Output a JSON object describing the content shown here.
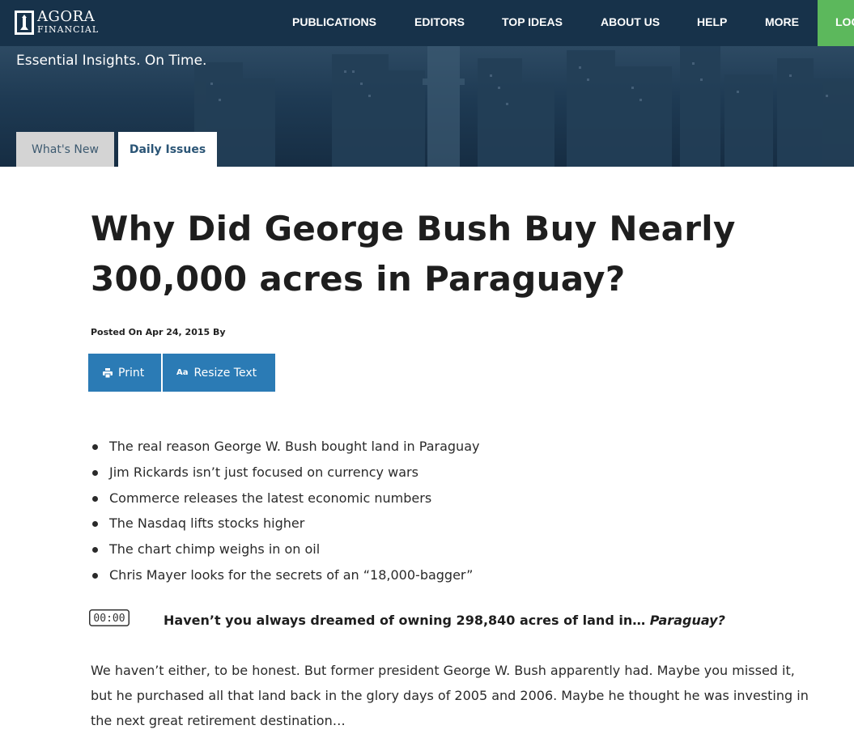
{
  "brand": {
    "name_top": "AGORA",
    "name_bottom": "FINANCIAL"
  },
  "nav": {
    "items": [
      "PUBLICATIONS",
      "EDITORS",
      "TOP IDEAS",
      "ABOUT US",
      "HELP",
      "MORE"
    ],
    "login": "LOGIN"
  },
  "hero": {
    "tagline": "Essential Insights. On Time.",
    "tabs": [
      "What's New",
      "Daily Issues"
    ]
  },
  "article": {
    "title": "Why Did George Bush Buy Nearly 300,000 acres in Paraguay?",
    "meta": "Posted On Apr 24, 2015 By",
    "print_label": "Print",
    "resize_label": "Resize Text",
    "aa_glyph": "Aa",
    "bullets": [
      "The real reason George W. Bush bought land in Paraguay",
      "Jim Rickards isn’t just focused on currency wars",
      "Commerce releases the latest economic numbers",
      "The Nasdaq lifts stocks higher",
      "The chart chimp weighs in on oil",
      "Chris Mayer looks for the secrets of an “18,000-bagger”"
    ],
    "timer_text": "00:00",
    "lead": "Haven’t you always dreamed of owning 298,840 acres of land in…",
    "lead_em": "Paraguay?",
    "paragraph": "We haven’t either, to be honest. But former president George W. Bush apparently had. Maybe you missed it, but he purchased all that land back in the glory days of 2005 and 2006. Maybe he thought he was investing in the next great retirement destination…"
  },
  "colors": {
    "nav_bg": "#17324a",
    "login_bg": "#5cb85c",
    "button_bg": "#2b7bb5",
    "tab_inactive": "#d4d4d4"
  },
  "icons": [
    "agora-logo-icon",
    "printer-icon",
    "text-size-icon",
    "timer-icon"
  ]
}
